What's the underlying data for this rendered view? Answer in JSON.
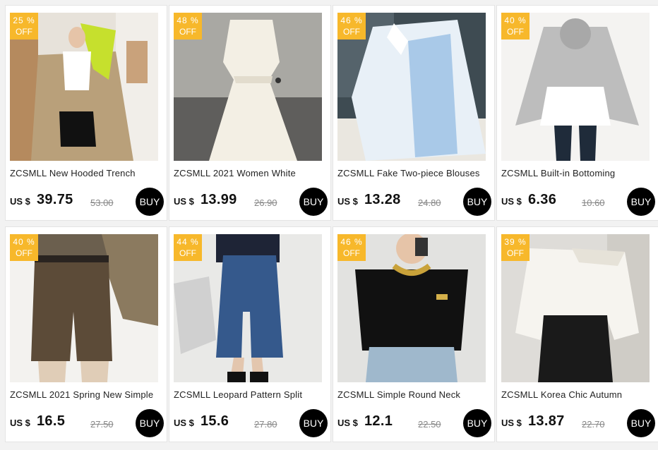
{
  "products": [
    {
      "discount": "25 %",
      "off_label": "OFF",
      "title": "ZCSMLL New Hooded Trench",
      "currency": "US $",
      "price": "39.75",
      "old_price": "53.00",
      "buy_label": "BUY",
      "photo_subject": "woman-in-khaki-trench-coat"
    },
    {
      "discount": "48 %",
      "off_label": "OFF",
      "title": "ZCSMLL 2021 Women White",
      "currency": "US $",
      "price": "13.99",
      "old_price": "26.90",
      "buy_label": "BUY",
      "photo_subject": "white-sleeveless-dress"
    },
    {
      "discount": "46 %",
      "off_label": "OFF",
      "title": "ZCSMLL Fake Two-piece Blouses",
      "currency": "US $",
      "price": "13.28",
      "old_price": "24.80",
      "buy_label": "BUY",
      "photo_subject": "blue-white-blouse"
    },
    {
      "discount": "40 %",
      "off_label": "OFF",
      "title": "ZCSMLL Built-in Bottoming",
      "currency": "US $",
      "price": "6.36",
      "old_price": "10.60",
      "buy_label": "BUY",
      "photo_subject": "grey-hoodie-white-skirt"
    },
    {
      "discount": "40 %",
      "off_label": "OFF",
      "title": "ZCSMLL 2021 Spring New Simple",
      "currency": "US $",
      "price": "16.5",
      "old_price": "27.50",
      "buy_label": "BUY",
      "photo_subject": "brown-shorts"
    },
    {
      "discount": "44 %",
      "off_label": "OFF",
      "title": "ZCSMLL Leopard Pattern Split",
      "currency": "US $",
      "price": "15.6",
      "old_price": "27.80",
      "buy_label": "BUY",
      "photo_subject": "blue-pattern-split-skirt"
    },
    {
      "discount": "46 %",
      "off_label": "OFF",
      "title": "ZCSMLL Simple Round Neck",
      "currency": "US $",
      "price": "12.1",
      "old_price": "22.50",
      "buy_label": "BUY",
      "photo_subject": "black-round-neck-tee"
    },
    {
      "discount": "39 %",
      "off_label": "OFF",
      "title": "ZCSMLL Korea Chic Autumn",
      "currency": "US $",
      "price": "13.87",
      "old_price": "22.70",
      "buy_label": "BUY",
      "photo_subject": "white-off-shoulder-shirt"
    }
  ],
  "colors": {
    "badge": "#f7b82b",
    "buy_button": "#000000",
    "page_bg": "#f2f2f2"
  }
}
